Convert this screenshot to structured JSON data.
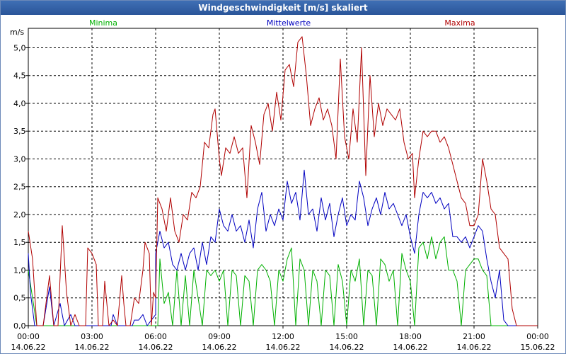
{
  "window": {
    "title": "Windgeschwindigkeit [m/s] skaliert"
  },
  "chart_data": {
    "type": "line",
    "title": "Windgeschwindigkeit [m/s] skaliert",
    "ylabel": "m/s",
    "xlabel": "",
    "ylim": [
      0,
      5.35
    ],
    "xlim": [
      0,
      24
    ],
    "grid": true,
    "legend_placement": "top",
    "y_ticks": [
      "0,0",
      "0,5",
      "1,0",
      "1,5",
      "2,0",
      "2,5",
      "3,0",
      "3,5",
      "4,0",
      "4,5",
      "5,0"
    ],
    "x_ticks": [
      {
        "time": "00:00",
        "date": "14.06.22"
      },
      {
        "time": "03:00",
        "date": "14.06.22"
      },
      {
        "time": "06:00",
        "date": "14.06.22"
      },
      {
        "time": "09:00",
        "date": "14.06.22"
      },
      {
        "time": "12:00",
        "date": "14.06.22"
      },
      {
        "time": "15:00",
        "date": "14.06.22"
      },
      {
        "time": "18:00",
        "date": "14.06.22"
      },
      {
        "time": "21:00",
        "date": "14.06.22"
      },
      {
        "time": "00:00",
        "date": "15.06.22"
      }
    ],
    "series": [
      {
        "name": "Minima",
        "color": "#00b000",
        "points": [
          [
            0,
            1.0
          ],
          [
            0.4,
            0.0
          ],
          [
            6.1,
            0.0
          ],
          [
            6.2,
            1.2
          ],
          [
            6.4,
            0.4
          ],
          [
            6.6,
            0.6
          ],
          [
            6.8,
            0.0
          ],
          [
            7.0,
            1.0
          ],
          [
            7.2,
            0.0
          ],
          [
            7.4,
            0.9
          ],
          [
            7.6,
            0.0
          ],
          [
            7.8,
            1.0
          ],
          [
            8.0,
            0.5
          ],
          [
            8.2,
            0.0
          ],
          [
            8.4,
            1.0
          ],
          [
            8.6,
            0.9
          ],
          [
            8.8,
            1.0
          ],
          [
            9.0,
            0.8
          ],
          [
            9.2,
            1.0
          ],
          [
            9.4,
            0.0
          ],
          [
            9.6,
            1.0
          ],
          [
            9.8,
            0.9
          ],
          [
            10.0,
            0.0
          ],
          [
            10.2,
            0.9
          ],
          [
            10.4,
            0.8
          ],
          [
            10.6,
            0.0
          ],
          [
            10.8,
            1.0
          ],
          [
            11.0,
            1.1
          ],
          [
            11.2,
            1.0
          ],
          [
            11.4,
            0.8
          ],
          [
            11.6,
            0.0
          ],
          [
            11.8,
            1.0
          ],
          [
            12.0,
            0.8
          ],
          [
            12.2,
            1.2
          ],
          [
            12.4,
            1.4
          ],
          [
            12.6,
            0.0
          ],
          [
            12.8,
            1.2
          ],
          [
            13.0,
            1.0
          ],
          [
            13.2,
            0.0
          ],
          [
            13.4,
            1.0
          ],
          [
            13.6,
            0.8
          ],
          [
            13.8,
            0.0
          ],
          [
            14.0,
            1.0
          ],
          [
            14.2,
            0.9
          ],
          [
            14.4,
            0.0
          ],
          [
            14.6,
            1.1
          ],
          [
            14.8,
            0.8
          ],
          [
            15.0,
            0.0
          ],
          [
            15.2,
            1.0
          ],
          [
            15.4,
            0.8
          ],
          [
            15.6,
            1.2
          ],
          [
            15.8,
            0.0
          ],
          [
            16.0,
            1.0
          ],
          [
            16.2,
            0.9
          ],
          [
            16.4,
            0.0
          ],
          [
            16.6,
            1.2
          ],
          [
            16.8,
            1.1
          ],
          [
            17.0,
            0.8
          ],
          [
            17.2,
            1.0
          ],
          [
            17.4,
            0.0
          ],
          [
            17.6,
            1.3
          ],
          [
            17.8,
            1.0
          ],
          [
            18.0,
            0.8
          ],
          [
            18.2,
            0.0
          ],
          [
            18.4,
            1.4
          ],
          [
            18.6,
            1.5
          ],
          [
            18.8,
            1.2
          ],
          [
            19.0,
            1.6
          ],
          [
            19.2,
            1.2
          ],
          [
            19.4,
            1.5
          ],
          [
            19.6,
            1.6
          ],
          [
            19.8,
            1.0
          ],
          [
            20.0,
            1.0
          ],
          [
            20.2,
            0.8
          ],
          [
            20.4,
            0.0
          ],
          [
            20.6,
            1.0
          ],
          [
            20.8,
            1.1
          ],
          [
            21.0,
            1.2
          ],
          [
            21.2,
            1.2
          ],
          [
            21.4,
            1.0
          ],
          [
            21.6,
            0.9
          ],
          [
            21.8,
            0.0
          ],
          [
            23.0,
            0.0
          ]
        ]
      },
      {
        "name": "Mittelwerte",
        "color": "#0000c0",
        "points": [
          [
            0,
            1.3
          ],
          [
            0.1,
            0.6
          ],
          [
            0.3,
            0.0
          ],
          [
            0.7,
            0.0
          ],
          [
            1.0,
            0.7
          ],
          [
            1.2,
            0.0
          ],
          [
            1.5,
            0.4
          ],
          [
            1.7,
            0.0
          ],
          [
            2.0,
            0.2
          ],
          [
            2.2,
            0.0
          ],
          [
            3.9,
            0.0
          ],
          [
            4.0,
            0.2
          ],
          [
            4.2,
            0.0
          ],
          [
            4.9,
            0.0
          ],
          [
            5.0,
            0.1
          ],
          [
            5.2,
            0.1
          ],
          [
            5.4,
            0.2
          ],
          [
            5.6,
            0.0
          ],
          [
            5.8,
            0.1
          ],
          [
            6.0,
            0.2
          ],
          [
            6.0,
            1.3
          ],
          [
            6.2,
            1.7
          ],
          [
            6.4,
            1.4
          ],
          [
            6.6,
            1.5
          ],
          [
            6.8,
            1.1
          ],
          [
            7.0,
            1.0
          ],
          [
            7.2,
            1.3
          ],
          [
            7.4,
            1.0
          ],
          [
            7.6,
            1.3
          ],
          [
            7.8,
            1.4
          ],
          [
            8.0,
            1.0
          ],
          [
            8.2,
            1.5
          ],
          [
            8.4,
            1.1
          ],
          [
            8.6,
            1.6
          ],
          [
            8.8,
            1.5
          ],
          [
            9.0,
            2.1
          ],
          [
            9.2,
            1.8
          ],
          [
            9.4,
            1.7
          ],
          [
            9.6,
            2.0
          ],
          [
            9.8,
            1.7
          ],
          [
            10.0,
            1.8
          ],
          [
            10.2,
            1.5
          ],
          [
            10.4,
            1.9
          ],
          [
            10.6,
            1.4
          ],
          [
            10.8,
            2.1
          ],
          [
            11.0,
            2.4
          ],
          [
            11.2,
            1.7
          ],
          [
            11.4,
            2.0
          ],
          [
            11.6,
            1.8
          ],
          [
            11.8,
            2.1
          ],
          [
            12.0,
            1.9
          ],
          [
            12.2,
            2.6
          ],
          [
            12.4,
            2.2
          ],
          [
            12.6,
            2.4
          ],
          [
            12.8,
            1.9
          ],
          [
            13.0,
            2.8
          ],
          [
            13.2,
            2.0
          ],
          [
            13.4,
            2.1
          ],
          [
            13.6,
            1.7
          ],
          [
            13.8,
            2.3
          ],
          [
            14.0,
            1.9
          ],
          [
            14.2,
            2.2
          ],
          [
            14.4,
            1.6
          ],
          [
            14.6,
            2.0
          ],
          [
            14.8,
            2.3
          ],
          [
            15.0,
            1.8
          ],
          [
            15.2,
            2.0
          ],
          [
            15.4,
            1.9
          ],
          [
            15.6,
            2.6
          ],
          [
            15.8,
            2.3
          ],
          [
            16.0,
            1.8
          ],
          [
            16.2,
            2.1
          ],
          [
            16.4,
            2.3
          ],
          [
            16.6,
            2.0
          ],
          [
            16.8,
            2.4
          ],
          [
            17.0,
            2.1
          ],
          [
            17.2,
            2.2
          ],
          [
            17.4,
            2.0
          ],
          [
            17.6,
            1.8
          ],
          [
            17.8,
            2.0
          ],
          [
            18.0,
            1.6
          ],
          [
            18.2,
            1.3
          ],
          [
            18.4,
            2.0
          ],
          [
            18.6,
            2.4
          ],
          [
            18.8,
            2.3
          ],
          [
            19.0,
            2.4
          ],
          [
            19.2,
            2.2
          ],
          [
            19.4,
            2.3
          ],
          [
            19.6,
            2.1
          ],
          [
            19.8,
            2.2
          ],
          [
            20.0,
            1.6
          ],
          [
            20.2,
            1.6
          ],
          [
            20.4,
            1.5
          ],
          [
            20.6,
            1.6
          ],
          [
            20.8,
            1.4
          ],
          [
            21.0,
            1.6
          ],
          [
            21.2,
            1.8
          ],
          [
            21.4,
            1.7
          ],
          [
            21.6,
            1.2
          ],
          [
            21.8,
            0.8
          ],
          [
            22.0,
            0.5
          ],
          [
            22.2,
            1.0
          ],
          [
            22.4,
            0.1
          ],
          [
            22.6,
            0.0
          ],
          [
            23.0,
            0.0
          ]
        ]
      },
      {
        "name": "Maxima",
        "color": "#b00000",
        "points": [
          [
            0,
            1.7
          ],
          [
            0.2,
            1.2
          ],
          [
            0.4,
            0.0
          ],
          [
            0.7,
            0.0
          ],
          [
            1.0,
            0.9
          ],
          [
            1.2,
            0.0
          ],
          [
            1.4,
            0.0
          ],
          [
            1.6,
            1.8
          ],
          [
            1.8,
            0.6
          ],
          [
            2.0,
            0.0
          ],
          [
            2.2,
            0.2
          ],
          [
            2.4,
            0.0
          ],
          [
            2.7,
            0.0
          ],
          [
            2.8,
            1.4
          ],
          [
            3.0,
            1.3
          ],
          [
            3.2,
            1.1
          ],
          [
            3.3,
            0.0
          ],
          [
            3.5,
            0.0
          ],
          [
            3.6,
            0.8
          ],
          [
            3.8,
            0.0
          ],
          [
            4.0,
            0.1
          ],
          [
            4.2,
            0.0
          ],
          [
            4.4,
            0.9
          ],
          [
            4.5,
            0.4
          ],
          [
            4.6,
            0.0
          ],
          [
            4.8,
            0.0
          ],
          [
            5.0,
            0.5
          ],
          [
            5.2,
            0.4
          ],
          [
            5.4,
            1.0
          ],
          [
            5.5,
            1.5
          ],
          [
            5.7,
            1.3
          ],
          [
            5.8,
            0.0
          ],
          [
            5.9,
            0.6
          ],
          [
            6.0,
            0.5
          ],
          [
            6.1,
            2.3
          ],
          [
            6.3,
            2.1
          ],
          [
            6.5,
            1.7
          ],
          [
            6.7,
            2.3
          ],
          [
            6.9,
            1.7
          ],
          [
            7.1,
            1.5
          ],
          [
            7.3,
            2.0
          ],
          [
            7.5,
            1.9
          ],
          [
            7.7,
            2.4
          ],
          [
            7.9,
            2.3
          ],
          [
            8.1,
            2.5
          ],
          [
            8.3,
            3.3
          ],
          [
            8.5,
            3.2
          ],
          [
            8.7,
            3.8
          ],
          [
            8.8,
            3.9
          ],
          [
            9.0,
            3.0
          ],
          [
            9.1,
            2.7
          ],
          [
            9.3,
            3.2
          ],
          [
            9.5,
            3.1
          ],
          [
            9.7,
            3.4
          ],
          [
            9.9,
            3.1
          ],
          [
            10.1,
            3.2
          ],
          [
            10.3,
            2.3
          ],
          [
            10.5,
            3.6
          ],
          [
            10.7,
            3.3
          ],
          [
            10.9,
            2.9
          ],
          [
            11.1,
            3.8
          ],
          [
            11.3,
            4.0
          ],
          [
            11.5,
            3.5
          ],
          [
            11.7,
            4.2
          ],
          [
            11.9,
            3.7
          ],
          [
            12.1,
            4.6
          ],
          [
            12.3,
            4.7
          ],
          [
            12.5,
            4.3
          ],
          [
            12.7,
            5.1
          ],
          [
            12.9,
            5.2
          ],
          [
            13.1,
            4.5
          ],
          [
            13.3,
            3.6
          ],
          [
            13.5,
            3.9
          ],
          [
            13.7,
            4.1
          ],
          [
            13.9,
            3.7
          ],
          [
            14.1,
            3.9
          ],
          [
            14.3,
            3.6
          ],
          [
            14.5,
            3.0
          ],
          [
            14.7,
            4.8
          ],
          [
            14.9,
            3.4
          ],
          [
            15.1,
            3.0
          ],
          [
            15.3,
            3.9
          ],
          [
            15.5,
            3.3
          ],
          [
            15.7,
            5.0
          ],
          [
            15.9,
            2.7
          ],
          [
            16.1,
            4.5
          ],
          [
            16.3,
            3.4
          ],
          [
            16.5,
            4.0
          ],
          [
            16.7,
            3.6
          ],
          [
            16.9,
            3.9
          ],
          [
            17.1,
            3.8
          ],
          [
            17.3,
            3.7
          ],
          [
            17.5,
            3.9
          ],
          [
            17.7,
            3.3
          ],
          [
            17.9,
            3.0
          ],
          [
            18.1,
            3.1
          ],
          [
            18.2,
            2.3
          ],
          [
            18.4,
            3.0
          ],
          [
            18.6,
            3.5
          ],
          [
            18.8,
            3.4
          ],
          [
            19.0,
            3.5
          ],
          [
            19.2,
            3.5
          ],
          [
            19.4,
            3.3
          ],
          [
            19.6,
            3.4
          ],
          [
            19.8,
            3.2
          ],
          [
            20.0,
            2.9
          ],
          [
            20.2,
            2.6
          ],
          [
            20.4,
            2.3
          ],
          [
            20.6,
            2.2
          ],
          [
            20.8,
            1.8
          ],
          [
            21.0,
            1.8
          ],
          [
            21.2,
            2.0
          ],
          [
            21.4,
            3.0
          ],
          [
            21.6,
            2.6
          ],
          [
            21.8,
            2.1
          ],
          [
            22.0,
            2.0
          ],
          [
            22.2,
            1.4
          ],
          [
            22.4,
            1.3
          ],
          [
            22.6,
            1.2
          ],
          [
            22.8,
            0.3
          ],
          [
            23.0,
            0.0
          ],
          [
            24.0,
            0.0
          ]
        ]
      }
    ]
  }
}
